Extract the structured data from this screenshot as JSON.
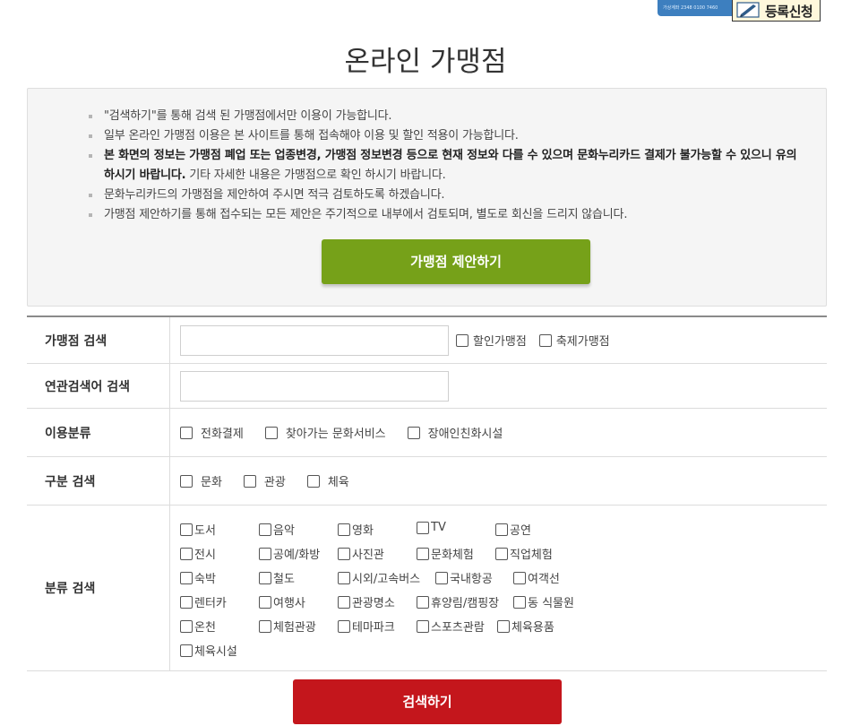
{
  "banner": {
    "small_text": "가상계좌 2348 0100 7460",
    "register_label": "등록신청"
  },
  "page": {
    "title": "온라인 가맹점"
  },
  "notice": {
    "items": [
      {
        "text": "\"검색하기\"를 통해 검색 된 가맹점에서만 이용이 가능합니다."
      },
      {
        "text": "일부 온라인 가맹점 이용은 본 사이트를 통해 접속해야 이용 및 할인 적용이 가능합니다."
      },
      {
        "bold": "본 화면의 정보는 가맹점 폐업 또는 업종변경, 가맹점 정보변경 등으로 현재 정보와 다를 수 있으며 문화누리카드 결제가 불가능할 수 있으니 유의하시기 바랍니다.",
        "text": " 기타 자세한 내용은 가맹점으로 확인 하시기 바랍니다."
      },
      {
        "text": "문화누리카드의 가맹점을 제안하여 주시면 적극 검토하도록 하겠습니다."
      },
      {
        "text": "가맹점 제안하기를 통해 접수되는 모든 제안은 주기적으로 내부에서 검토되며, 별도로 회신을 드리지 않습니다."
      }
    ],
    "propose_button": "가맹점 제안하기"
  },
  "search": {
    "store": {
      "label": "가맹점 검색",
      "value": "",
      "discount_label": "할인가맹점",
      "festival_label": "축제가맹점"
    },
    "keyword": {
      "label": "연관검색어 검색",
      "value": ""
    },
    "usage": {
      "label": "이용분류",
      "options": [
        "전화결제",
        "찾아가는 문화서비스",
        "장애인친화시설"
      ]
    },
    "division": {
      "label": "구분 검색",
      "options": [
        "문화",
        "관광",
        "체육"
      ]
    },
    "category": {
      "label": "분류 검색",
      "options": [
        "도서",
        "음악",
        "영화",
        "TV",
        "공연",
        "전시",
        "공예/화방",
        "사진관",
        "문화체험",
        "직업체험",
        "숙박",
        "철도",
        "시외/고속버스",
        "국내항공",
        "여객선",
        "렌터카",
        "여행사",
        "관광명소",
        "휴양림/캠핑장",
        "동 식물원",
        "온천",
        "체험관광",
        "테마파크",
        "스포츠관람",
        "체육용품",
        "체육시설"
      ]
    },
    "submit_button": "검색하기"
  }
}
